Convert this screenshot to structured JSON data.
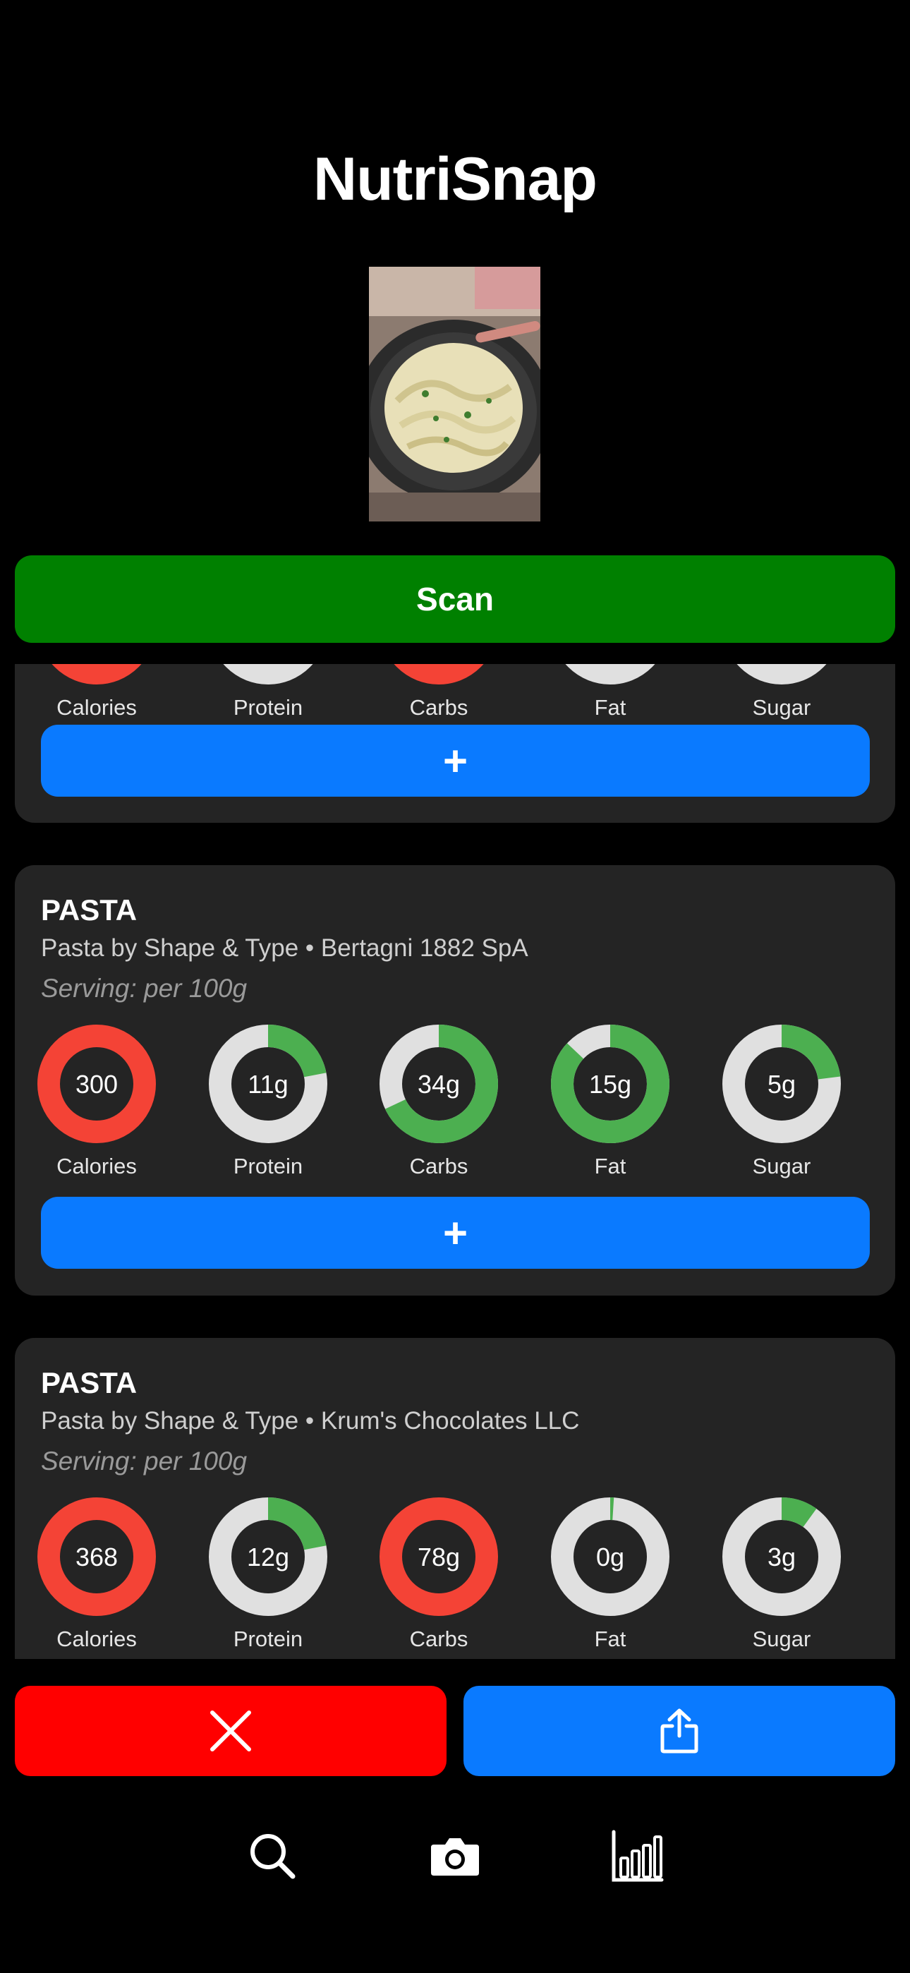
{
  "app": {
    "title": "NutriSnap"
  },
  "scan_button": {
    "label": "Scan"
  },
  "icons": {
    "close": "close-icon",
    "share": "share-icon",
    "search": "search-icon",
    "camera": "camera-icon",
    "stats": "bar-chart-icon"
  },
  "colors": {
    "scan": "#008000",
    "add": "#0a7aff",
    "delete": "#ff0000",
    "ring_track": "#e0e0e0",
    "ring_ok": "#4caf50",
    "ring_over": "#f44336"
  },
  "cards": [
    {
      "name": "",
      "subtitle": "",
      "serving": "",
      "nutrients": [
        {
          "label": "Calories",
          "value": "",
          "fraction": 1.0,
          "status": "over"
        },
        {
          "label": "Protein",
          "value": "",
          "fraction": 0.0,
          "status": "ok"
        },
        {
          "label": "Carbs",
          "value": "",
          "fraction": 1.0,
          "status": "over"
        },
        {
          "label": "Fat",
          "value": "",
          "fraction": 0.0,
          "status": "ok"
        },
        {
          "label": "Sugar",
          "value": "",
          "fraction": 0.0,
          "status": "ok"
        }
      ],
      "add_label": "+"
    },
    {
      "name": "PASTA",
      "subtitle": "Pasta by Shape & Type • Bertagni 1882 SpA",
      "serving": "Serving: per 100g",
      "nutrients": [
        {
          "label": "Calories",
          "value": "300",
          "fraction": 1.0,
          "status": "over"
        },
        {
          "label": "Protein",
          "value": "11g",
          "fraction": 0.22,
          "status": "ok"
        },
        {
          "label": "Carbs",
          "value": "34g",
          "fraction": 0.68,
          "status": "ok"
        },
        {
          "label": "Fat",
          "value": "15g",
          "fraction": 0.87,
          "status": "ok"
        },
        {
          "label": "Sugar",
          "value": "5g",
          "fraction": 0.23,
          "status": "ok"
        }
      ],
      "add_label": "+"
    },
    {
      "name": "PASTA",
      "subtitle": "Pasta by Shape & Type • Krum's Chocolates LLC",
      "serving": "Serving: per 100g",
      "nutrients": [
        {
          "label": "Calories",
          "value": "368",
          "fraction": 1.0,
          "status": "over"
        },
        {
          "label": "Protein",
          "value": "12g",
          "fraction": 0.22,
          "status": "ok"
        },
        {
          "label": "Carbs",
          "value": "78g",
          "fraction": 1.0,
          "status": "over"
        },
        {
          "label": "Fat",
          "value": "0g",
          "fraction": 0.01,
          "status": "ok"
        },
        {
          "label": "Sugar",
          "value": "3g",
          "fraction": 0.1,
          "status": "ok"
        }
      ],
      "add_label": "+"
    }
  ]
}
